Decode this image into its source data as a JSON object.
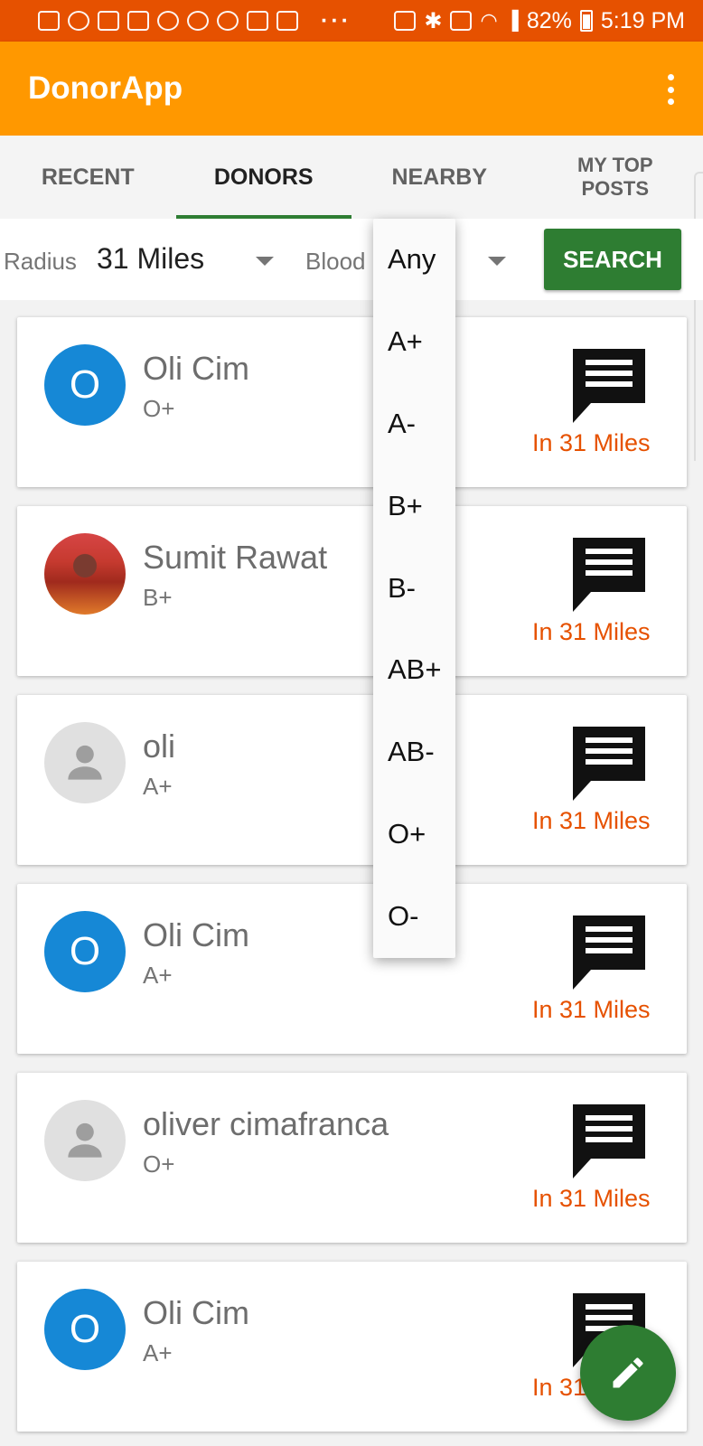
{
  "status_bar": {
    "battery": "82%",
    "time": "5:19 PM",
    "overflow": "···"
  },
  "app_bar": {
    "title": "DonorApp"
  },
  "tabs": [
    {
      "label": "RECENT",
      "active": false
    },
    {
      "label": "DONORS",
      "active": true
    },
    {
      "label": "NEARBY",
      "active": false
    },
    {
      "label": "MY TOP POSTS",
      "active": false
    }
  ],
  "filters": {
    "radius_label": "Radius",
    "radius_value": "31 Miles",
    "blood_label": "Blood",
    "search_label": "SEARCH"
  },
  "blood_dropdown": {
    "options": [
      "Any",
      "A+",
      "A-",
      "B+",
      "B-",
      "AB+",
      "AB-",
      "O+",
      "O-"
    ]
  },
  "donors": [
    {
      "initial": "O",
      "name": "Oli Cim",
      "blood": "O+",
      "distance": "In 31 Miles",
      "avatar": "letter"
    },
    {
      "initial": "",
      "name": "Sumit Rawat",
      "blood": "B+",
      "distance": "In 31 Miles",
      "avatar": "photo"
    },
    {
      "initial": "",
      "name": "oli",
      "blood": "A+",
      "distance": "In 31 Miles",
      "avatar": "placeholder"
    },
    {
      "initial": "O",
      "name": "Oli Cim",
      "blood": "A+",
      "distance": "In 31 Miles",
      "avatar": "letter"
    },
    {
      "initial": "",
      "name": "oliver cimafranca",
      "blood": "O+",
      "distance": "In 31 Miles",
      "avatar": "placeholder"
    },
    {
      "initial": "O",
      "name": "Oli Cim",
      "blood": "A+",
      "distance": "In 31 Miles",
      "avatar": "letter"
    }
  ],
  "colors": {
    "status_bar": "#e65100",
    "app_bar": "#ff9800",
    "accent_green": "#2e7d32",
    "avatar_blue": "#1688d6",
    "distance_orange": "#e65100"
  },
  "icons": {
    "menu": "more-vert-icon",
    "chat": "message-icon",
    "fab": "edit-icon"
  }
}
